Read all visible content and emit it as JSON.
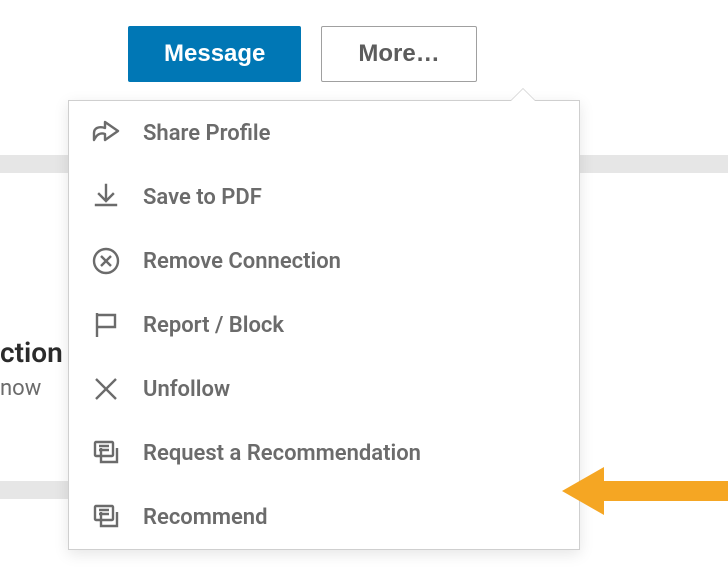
{
  "buttons": {
    "message": "Message",
    "more": "More…"
  },
  "menu": {
    "items": [
      {
        "icon": "share-icon",
        "label": "Share Profile"
      },
      {
        "icon": "download-icon",
        "label": "Save to PDF"
      },
      {
        "icon": "remove-icon",
        "label": "Remove Connection"
      },
      {
        "icon": "flag-icon",
        "label": "Report / Block"
      },
      {
        "icon": "unfollow-icon",
        "label": "Unfollow"
      },
      {
        "icon": "request-rec-icon",
        "label": "Request a Recommendation"
      },
      {
        "icon": "recommend-icon",
        "label": "Recommend"
      }
    ]
  },
  "cut_text": {
    "heading": "ction",
    "sub": "now"
  },
  "colors": {
    "primary": "#0077b5",
    "arrow": "#f5a623"
  }
}
